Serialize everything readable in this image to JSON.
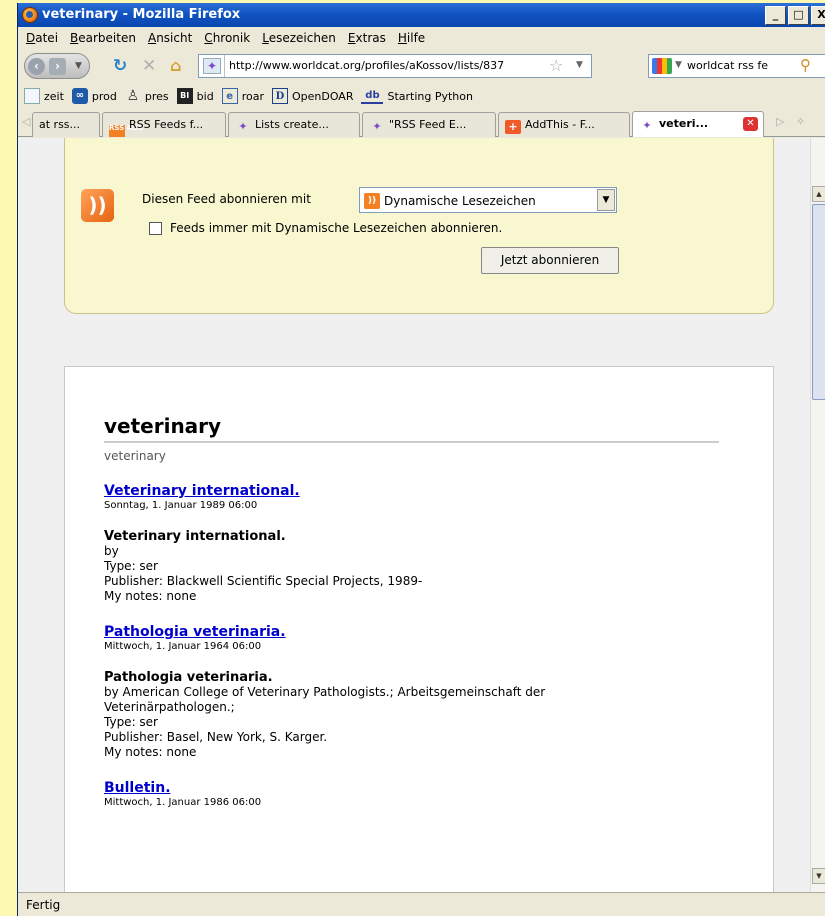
{
  "window": {
    "title": "veterinary - Mozilla Firefox",
    "minimize": "_",
    "maximize": "□",
    "close": "X"
  },
  "menu": [
    "Datei",
    "Bearbeiten",
    "Ansicht",
    "Chronik",
    "Lesezeichen",
    "Extras",
    "Hilfe"
  ],
  "nav": {
    "url": "http://www.worldcat.org/profiles/aKossov/lists/837",
    "search_value": "worldcat rss fe",
    "search_engine_icon": "google-icon"
  },
  "bookmarks": [
    "zeit",
    "prod",
    "pres",
    "bid",
    "roar",
    "OpenDOAR",
    "Starting Python"
  ],
  "bookmark_icon_glyphs": {
    "prod": "∞",
    "pres": "♙",
    "bid": "BI",
    "roar": "e",
    "opendoar": "D",
    "starting_python": "db"
  },
  "tabs": [
    {
      "label": "at rss..."
    },
    {
      "label": "RSS Feeds f..."
    },
    {
      "label": "Lists create..."
    },
    {
      "label": "\"RSS Feed E..."
    },
    {
      "label": "AddThis - F..."
    },
    {
      "label": "veteri...",
      "active": true
    }
  ],
  "feed_subscribe": {
    "label": "Diesen Feed abonnieren mit",
    "reader": "Dynamische Lesezeichen",
    "always_label": "Feeds immer mit Dynamische Lesezeichen abonnieren.",
    "always_checked": false,
    "button": "Jetzt abonnieren"
  },
  "feed": {
    "title": "veterinary",
    "subtitle": "veterinary",
    "entries": [
      {
        "link": "Veterinary international.",
        "date": "Sonntag, 1. Januar 1989 06:00",
        "body_title": "Veterinary international.",
        "by": "by",
        "type": "Type: ser",
        "publisher": "Publisher: Blackwell Scientific Special Projects, 1989-",
        "notes": "My notes: none"
      },
      {
        "link": "Pathologia veterinaria.",
        "date": "Mittwoch, 1. Januar 1964 06:00",
        "body_title": "Pathologia veterinaria.",
        "by_line1": "by American College of Veterinary Pathologists.; Arbeitsgemeinschaft der",
        "by_line2": "Veterinärpathologen.;",
        "type": "Type: ser",
        "publisher": "Publisher: Basel, New York, S. Karger.",
        "notes": "My notes: none"
      },
      {
        "link": "Bulletin.",
        "date": "Mittwoch, 1. Januar 1986 06:00"
      }
    ]
  },
  "status": "Fertig",
  "colors": {
    "link": "#0000cc",
    "feed_box_bg": "#f8f7d0",
    "titlebar": "#0a46b0",
    "page_bg": "#fdf9b3"
  }
}
